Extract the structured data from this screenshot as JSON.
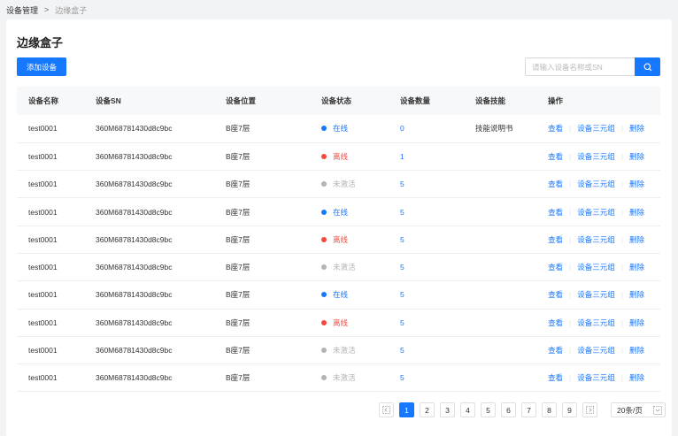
{
  "breadcrumb": {
    "root": "设备管理",
    "separator": ">",
    "current": "边缘盒子"
  },
  "page_title": "边缘盒子",
  "toolbar": {
    "add_label": "添加设备"
  },
  "search": {
    "placeholder": "请输入设备名称或SN"
  },
  "table": {
    "headers": [
      "设备名称",
      "设备SN",
      "设备位置",
      "设备状态",
      "设备数量",
      "设备技能",
      "操作"
    ],
    "rows": [
      {
        "name": "test0001",
        "sn": "360M68781430d8c9bc",
        "location": "B座7层",
        "status": "在线",
        "status_kind": "online",
        "count": "0",
        "skill": "技能说明书"
      },
      {
        "name": "test0001",
        "sn": "360M68781430d8c9bc",
        "location": "B座7层",
        "status": "离线",
        "status_kind": "offline",
        "count": "1",
        "skill": ""
      },
      {
        "name": "test0001",
        "sn": "360M68781430d8c9bc",
        "location": "B座7层",
        "status": "未激活",
        "status_kind": "inactive",
        "count": "5",
        "skill": ""
      },
      {
        "name": "test0001",
        "sn": "360M68781430d8c9bc",
        "location": "B座7层",
        "status": "在线",
        "status_kind": "online",
        "count": "5",
        "skill": ""
      },
      {
        "name": "test0001",
        "sn": "360M68781430d8c9bc",
        "location": "B座7层",
        "status": "离线",
        "status_kind": "offline",
        "count": "5",
        "skill": ""
      },
      {
        "name": "test0001",
        "sn": "360M68781430d8c9bc",
        "location": "B座7层",
        "status": "未激活",
        "status_kind": "inactive",
        "count": "5",
        "skill": ""
      },
      {
        "name": "test0001",
        "sn": "360M68781430d8c9bc",
        "location": "B座7层",
        "status": "在线",
        "status_kind": "online",
        "count": "5",
        "skill": ""
      },
      {
        "name": "test0001",
        "sn": "360M68781430d8c9bc",
        "location": "B座7层",
        "status": "离线",
        "status_kind": "offline",
        "count": "5",
        "skill": ""
      },
      {
        "name": "test0001",
        "sn": "360M68781430d8c9bc",
        "location": "B座7层",
        "status": "未激活",
        "status_kind": "inactive",
        "count": "5",
        "skill": ""
      },
      {
        "name": "test0001",
        "sn": "360M68781430d8c9bc",
        "location": "B座7层",
        "status": "未激活",
        "status_kind": "inactive",
        "count": "5",
        "skill": ""
      }
    ],
    "actions": {
      "view": "查看",
      "triple": "设备三元组",
      "delete": "删除"
    }
  },
  "status_colors": {
    "online": "#1677ff",
    "offline": "#f5483b",
    "inactive": "#b3b3b3"
  },
  "accent_color": "#1677ff",
  "pagination": {
    "pages": [
      "1",
      "2",
      "3",
      "4",
      "5",
      "6",
      "7",
      "8",
      "9"
    ],
    "current": "1",
    "page_size": "20条/页",
    "prev_icon": "jump-prev-icon",
    "next_icon": "jump-next-icon"
  }
}
